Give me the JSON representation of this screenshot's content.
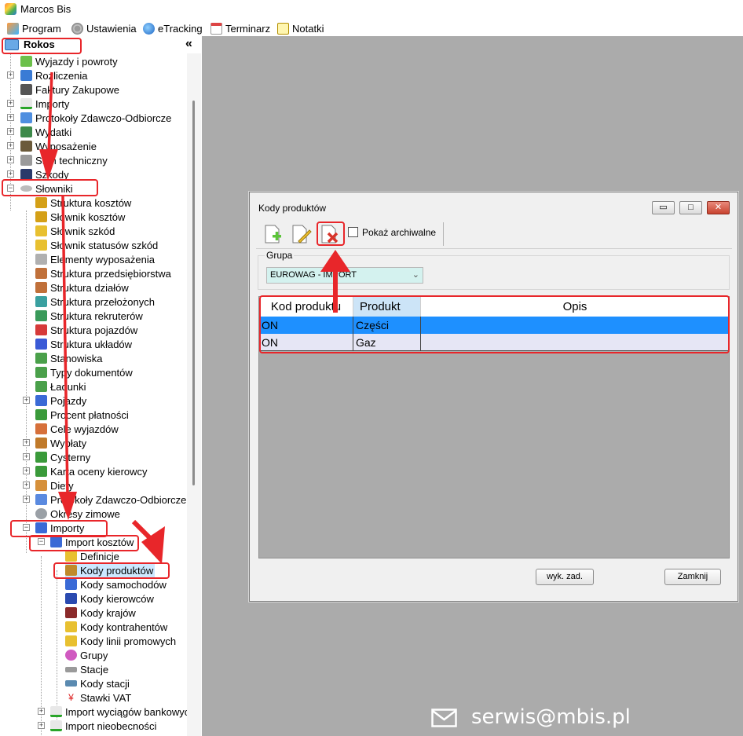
{
  "app": {
    "title": "Marcos Bis"
  },
  "menu": [
    {
      "label": "Program",
      "icon": "program-icon"
    },
    {
      "label": "Ustawienia",
      "icon": "settings-gear-icon"
    },
    {
      "label": "eTracking",
      "icon": "globe-icon"
    },
    {
      "label": "Terminarz",
      "icon": "calendar-icon"
    },
    {
      "label": "Notatki",
      "icon": "notes-icon"
    }
  ],
  "panel": {
    "root_label": "Rokos",
    "collapse_glyph": "«"
  },
  "tree": {
    "level0": [
      {
        "label": "Wyjazdy i powroty",
        "icon": "arrows-icon"
      },
      {
        "label": "Rozliczenia",
        "icon": "checklist-icon"
      },
      {
        "label": "Faktury Zakupowe",
        "icon": "invoice-icon"
      },
      {
        "label": "Importy",
        "icon": "import-icon"
      },
      {
        "label": "Protokoły Zdawczo-Odbiorcze",
        "icon": "protocol-icon"
      },
      {
        "label": "Wydatki",
        "icon": "expenses-icon"
      },
      {
        "label": "Wyposażenie",
        "icon": "equipment-icon"
      },
      {
        "label": "Stan techniczny",
        "icon": "wrench-icon"
      },
      {
        "label": "Szkody",
        "icon": "damage-icon"
      },
      {
        "label": "Słowniki",
        "icon": "dictionary-icon"
      }
    ],
    "slowniki_children": [
      {
        "label": "Struktura kosztów",
        "icon": "cost-structure-icon"
      },
      {
        "label": "Słownik kosztów",
        "icon": "cost-dictionary-icon"
      },
      {
        "label": "Słownik szkód",
        "icon": "damage-dictionary-icon"
      },
      {
        "label": "Słownik statusów szkód",
        "icon": "damage-status-icon"
      },
      {
        "label": "Elementy wyposażenia",
        "icon": "equipment-elements-icon"
      },
      {
        "label": "Struktura przedsiębiorstwa",
        "icon": "company-structure-icon"
      },
      {
        "label": "Struktura działów",
        "icon": "departments-icon"
      },
      {
        "label": "Struktura przełożonych",
        "icon": "supervisors-icon"
      },
      {
        "label": "Struktura rekruterów",
        "icon": "recruiters-icon"
      },
      {
        "label": "Struktura pojazdów",
        "icon": "vehicles-structure-icon"
      },
      {
        "label": "Struktura układów",
        "icon": "layouts-icon"
      },
      {
        "label": "Stanowiska",
        "icon": "positions-icon"
      },
      {
        "label": "Typy dokumentów",
        "icon": "document-types-icon"
      },
      {
        "label": "Ładunki",
        "icon": "cargo-icon"
      },
      {
        "label": "Pojazdy",
        "icon": "truck-icon"
      },
      {
        "label": "Procent płatności",
        "icon": "payment-percent-icon"
      },
      {
        "label": "Cele wyjazdów",
        "icon": "trip-goals-icon"
      },
      {
        "label": "Wypłaty",
        "icon": "payouts-icon"
      },
      {
        "label": "Cysterny",
        "icon": "tankers-icon"
      },
      {
        "label": "Karta oceny kierowcy",
        "icon": "driver-rating-icon"
      },
      {
        "label": "Diety",
        "icon": "allowances-icon"
      },
      {
        "label": "Protokoły Zdawczo-Odbiorcze",
        "icon": "protocols-icon"
      },
      {
        "label": "Okresy zimowe",
        "icon": "winter-icon"
      },
      {
        "label": "Importy",
        "icon": "imports-folder-icon"
      }
    ],
    "importy_children": [
      {
        "label": "Import kosztów",
        "icon": "cost-import-icon"
      }
    ],
    "import_kosztow_children": [
      {
        "label": "Definicje",
        "icon": "definitions-icon"
      },
      {
        "label": "Kody produktów",
        "icon": "product-codes-icon"
      },
      {
        "label": "Kody samochodów",
        "icon": "car-codes-icon"
      },
      {
        "label": "Kody kierowców",
        "icon": "driver-codes-icon"
      },
      {
        "label": "Kody krajów",
        "icon": "country-codes-icon"
      },
      {
        "label": "Kody kontrahentów",
        "icon": "contractor-codes-icon"
      },
      {
        "label": "Kody linii promowych",
        "icon": "ferry-codes-icon"
      },
      {
        "label": "Grupy",
        "icon": "groups-icon"
      },
      {
        "label": "Stacje",
        "icon": "stations-icon"
      },
      {
        "label": "Kody stacji",
        "icon": "station-codes-icon"
      },
      {
        "label": "Stawki VAT",
        "icon": "vat-rates-icon"
      }
    ],
    "importy_more": [
      {
        "label": "Import wyciągów bankowych",
        "icon": "bank-import-icon"
      },
      {
        "label": "Import nieobecności",
        "icon": "absence-import-icon"
      }
    ]
  },
  "dialog": {
    "title": "Kody produktów",
    "window_buttons": {
      "minimize": "▭",
      "maximize": "□",
      "close": "✕"
    },
    "toolbar": {
      "add_icon": "add-document-icon",
      "edit_icon": "edit-document-icon",
      "delete_icon": "delete-document-icon",
      "show_archived_label": "Pokaż archiwalne",
      "show_archived_checked": false
    },
    "group": {
      "label": "Grupa",
      "value": "EUROWAG - IMPORT"
    },
    "grid": {
      "columns": [
        "Kod produktu",
        "Produkt",
        "Opis"
      ],
      "rows": [
        {
          "kod": "ON",
          "produkt": "Części",
          "opis": "",
          "selected": true
        },
        {
          "kod": "ON",
          "produkt": "Gaz",
          "opis": "",
          "selected": false
        }
      ]
    },
    "buttons": {
      "wyk_zad": "wyk. zad.",
      "close": "Zamknij"
    }
  },
  "watermark": {
    "email": "serwis@mbis.pl"
  },
  "colors": {
    "annotation_red": "#e8262a",
    "selected_row": "#1e90ff",
    "workspace_bg": "#ababab",
    "selected_tree_item": "#cce8ff"
  }
}
